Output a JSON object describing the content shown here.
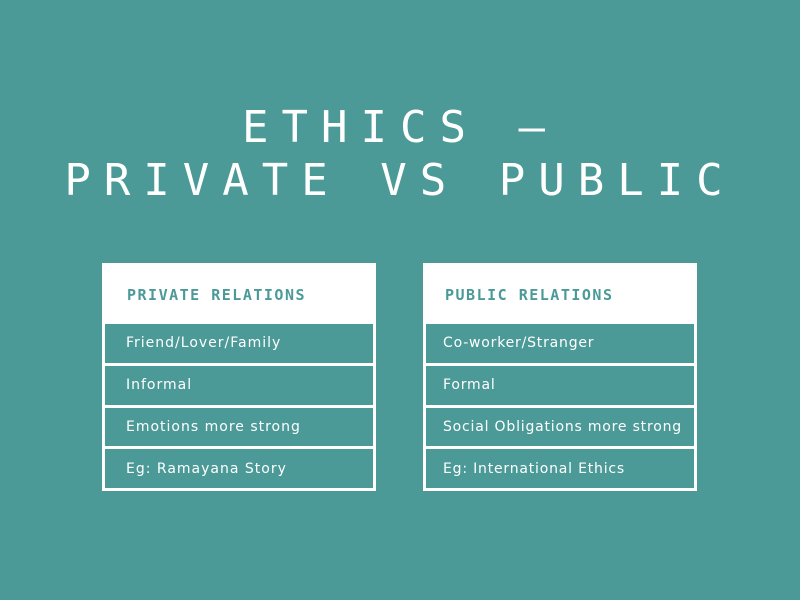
{
  "title": {
    "line1": "ETHICS –",
    "line2": "PRIVATE VS PUBLIC"
  },
  "private_panel": {
    "header": "PRIVATE RELATIONS",
    "rows": [
      "Friend/Lover/Family",
      "Informal",
      "Emotions more strong",
      "Eg: Ramayana Story"
    ]
  },
  "public_panel": {
    "header": "PUBLIC RELATIONS",
    "rows": [
      "Co-worker/Stranger",
      "Formal",
      "Social Obligations more strong",
      "Eg: International Ethics"
    ]
  },
  "colors": {
    "background": "#4b9a98",
    "text_light": "#ffffff",
    "panel_border": "#ffffff"
  }
}
